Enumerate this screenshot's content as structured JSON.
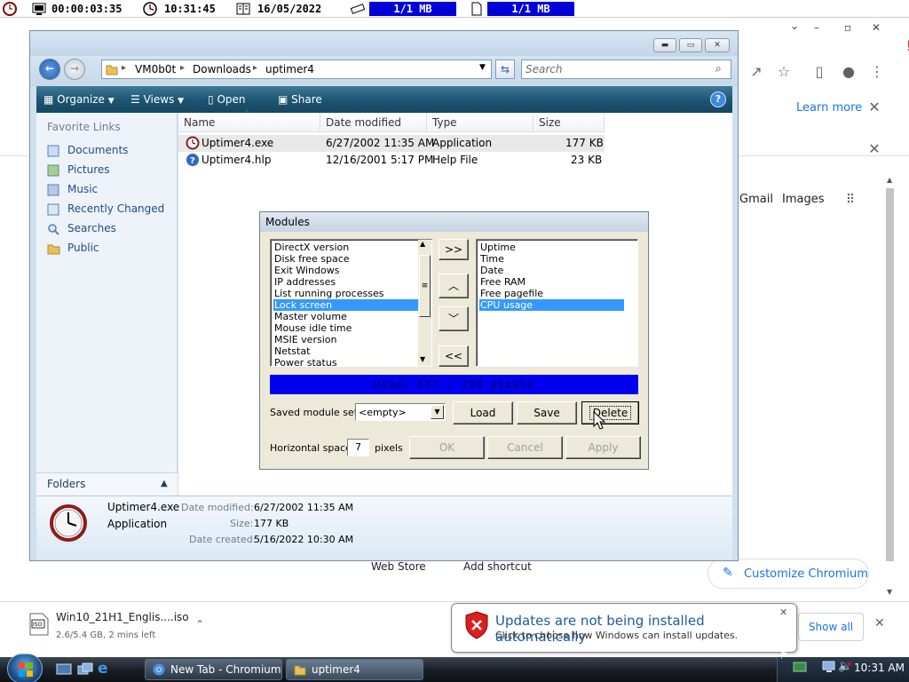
{
  "uptimer": {
    "uptime": "00:00:03:35",
    "clock": "10:31:45",
    "date": "16/05/2022",
    "ram": "1/1 MB",
    "pagefile": "1/1 MB"
  },
  "chromium": {
    "learn_more": "Learn more",
    "gmail": "Gmail",
    "images": "Images",
    "web_store": "Web Store",
    "add_shortcut": "Add shortcut",
    "customize": "Customize Chromium",
    "download": {
      "filename": "Win10_21H1_Englis....iso",
      "status": "2.6/5.4 GB, 2 mins left",
      "show_all": "Show all"
    }
  },
  "explorer": {
    "breadcrumb": [
      "VM0b0t",
      "Downloads",
      "uptimer4"
    ],
    "search_placeholder": "Search",
    "toolbar": {
      "organize": "Organize",
      "views": "Views",
      "open": "Open",
      "share": "Share"
    },
    "favorite_links_title": "Favorite Links",
    "favorites": [
      "Documents",
      "Pictures",
      "Music",
      "Recently Changed",
      "Searches",
      "Public"
    ],
    "folders_label": "Folders",
    "columns": [
      "Name",
      "Date modified",
      "Type",
      "Size"
    ],
    "files": [
      {
        "name": "Uptimer4.exe",
        "date": "6/27/2002 11:35 AM",
        "type": "Application",
        "size": "177 KB"
      },
      {
        "name": "Uptimer4.hlp",
        "date": "12/16/2001 5:17 PM",
        "type": "Help File",
        "size": "23 KB"
      }
    ],
    "details": {
      "name": "Uptimer4.exe",
      "type": "Application",
      "modified_label": "Date modified:",
      "modified": "6/27/2002 11:35 AM",
      "size_label": "Size:",
      "size": "177 KB",
      "created_label": "Date created:",
      "created": "5/16/2022 10:30 AM"
    }
  },
  "modules_dialog": {
    "title": "Modules",
    "available": [
      "DirectX version",
      "Disk free space",
      "Exit Windows",
      "IP addresses",
      "List running processes",
      "Lock screen",
      "Master volume",
      "Mouse idle time",
      "MSIE version",
      "Netstat",
      "Power status"
    ],
    "available_selected": "Lock screen",
    "active": [
      "Uptime",
      "Time",
      "Date",
      "Free RAM",
      "Free pagefile",
      "CPU usage"
    ],
    "active_selected": "CPU usage",
    "buttons": {
      "add": ">>",
      "up": "^",
      "down": "v",
      "remove": "<<"
    },
    "usage_text": "Used: 677 / 798 pixels",
    "saved_sets_label": "Saved module sets:",
    "saved_sets_value": "<empty>",
    "load": "Load",
    "save": "Save",
    "delete": "Delete",
    "spacer_label": "Horizontal spacer:",
    "spacer_value": "7",
    "spacer_unit": "pixels",
    "ok": "OK",
    "cancel": "Cancel",
    "apply": "Apply"
  },
  "notification": {
    "title": "Updates are not being installed automatically",
    "body": "Click to choose how Windows can install updates."
  },
  "taskbar": {
    "tasks": [
      "New Tab - Chromium",
      "uptimer4"
    ],
    "time": "10:31 AM"
  },
  "colors": {
    "uptimer_blue": "#0000d8",
    "explorer_toolbar": "#1e5674",
    "chrome_link": "#1a73e8",
    "selection": "#3399ff",
    "usage_bar": "#0000ee"
  }
}
